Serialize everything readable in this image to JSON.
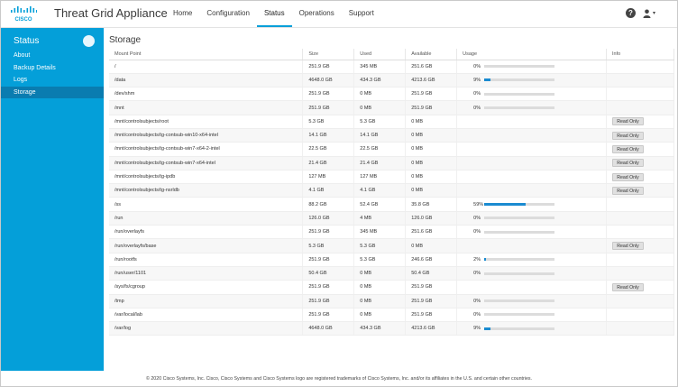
{
  "header": {
    "brand": "CISCO",
    "title": "Threat Grid Appliance",
    "nav": [
      "Home",
      "Configuration",
      "Status",
      "Operations",
      "Support"
    ],
    "active_nav": "Status",
    "help_glyph": "?"
  },
  "sidebar": {
    "title": "Status",
    "items": [
      "About",
      "Backup Details",
      "Logs",
      "Storage"
    ],
    "active": "Storage"
  },
  "main": {
    "title": "Storage",
    "columns": [
      "Mount Point",
      "Size",
      "Used",
      "Available",
      "Usage",
      "Info"
    ],
    "rows": [
      {
        "mount": "/",
        "size": "251.9 GB",
        "used": "345 MB",
        "avail": "251.6 GB",
        "usage": "0%",
        "pct": 0,
        "info": ""
      },
      {
        "mount": "/data",
        "size": "4648.0 GB",
        "used": "434.3 GB",
        "avail": "4213.6 GB",
        "usage": "9%",
        "pct": 9,
        "info": ""
      },
      {
        "mount": "/dev/shm",
        "size": "251.9 GB",
        "used": "0 MB",
        "avail": "251.9 GB",
        "usage": "0%",
        "pct": 0,
        "info": ""
      },
      {
        "mount": "/mnt",
        "size": "251.9 GB",
        "used": "0 MB",
        "avail": "251.9 GB",
        "usage": "0%",
        "pct": 0,
        "info": ""
      },
      {
        "mount": "/mnt/controlsubjects/root",
        "size": "5.3 GB",
        "used": "5.3 GB",
        "avail": "0 MB",
        "usage": "",
        "pct": null,
        "info": "Read Only"
      },
      {
        "mount": "/mnt/controlsubjects/tg-contsub-win10-x64-intel",
        "size": "14.1 GB",
        "used": "14.1 GB",
        "avail": "0 MB",
        "usage": "",
        "pct": null,
        "info": "Read Only"
      },
      {
        "mount": "/mnt/controlsubjects/tg-contsub-win7-x64-2-intel",
        "size": "22.5 GB",
        "used": "22.5 GB",
        "avail": "0 MB",
        "usage": "",
        "pct": null,
        "info": "Read Only"
      },
      {
        "mount": "/mnt/controlsubjects/tg-contsub-win7-x64-intel",
        "size": "21.4 GB",
        "used": "21.4 GB",
        "avail": "0 MB",
        "usage": "",
        "pct": null,
        "info": "Read Only"
      },
      {
        "mount": "/mnt/controlsubjects/tg-ipdb",
        "size": "127 MB",
        "used": "127 MB",
        "avail": "0 MB",
        "usage": "",
        "pct": null,
        "info": "Read Only"
      },
      {
        "mount": "/mnt/controlsubjects/tg-nsrldb",
        "size": "4.1 GB",
        "used": "4.1 GB",
        "avail": "0 MB",
        "usage": "",
        "pct": null,
        "info": "Read Only"
      },
      {
        "mount": "/ss",
        "size": "88.2 GB",
        "used": "52.4 GB",
        "avail": "35.8 GB",
        "usage": "59%",
        "pct": 59,
        "info": ""
      },
      {
        "mount": "/run",
        "size": "126.0 GB",
        "used": "4 MB",
        "avail": "126.0 GB",
        "usage": "0%",
        "pct": 0,
        "info": ""
      },
      {
        "mount": "/run/overlayfs",
        "size": "251.9 GB",
        "used": "345 MB",
        "avail": "251.6 GB",
        "usage": "0%",
        "pct": 0,
        "info": ""
      },
      {
        "mount": "/run/overlayfs/base",
        "size": "5.3 GB",
        "used": "5.3 GB",
        "avail": "0 MB",
        "usage": "",
        "pct": null,
        "info": "Read Only"
      },
      {
        "mount": "/run/rootfs",
        "size": "251.9 GB",
        "used": "5.3 GB",
        "avail": "246.6 GB",
        "usage": "2%",
        "pct": 2,
        "info": ""
      },
      {
        "mount": "/run/user/1101",
        "size": "50.4 GB",
        "used": "0 MB",
        "avail": "50.4 GB",
        "usage": "0%",
        "pct": 0,
        "info": ""
      },
      {
        "mount": "/sys/fs/cgroup",
        "size": "251.9 GB",
        "used": "0 MB",
        "avail": "251.9 GB",
        "usage": "",
        "pct": null,
        "info": "Read Only"
      },
      {
        "mount": "/tmp",
        "size": "251.9 GB",
        "used": "0 MB",
        "avail": "251.9 GB",
        "usage": "0%",
        "pct": 0,
        "info": ""
      },
      {
        "mount": "/var/local/lab",
        "size": "251.9 GB",
        "used": "0 MB",
        "avail": "251.9 GB",
        "usage": "0%",
        "pct": 0,
        "info": ""
      },
      {
        "mount": "/var/log",
        "size": "4648.0 GB",
        "used": "434.3 GB",
        "avail": "4213.6 GB",
        "usage": "9%",
        "pct": 9,
        "info": ""
      }
    ]
  },
  "footer": {
    "text": "© 2020 Cisco Systems, Inc. Cisco, Cisco Systems and Cisco Systems logo are registered trademarks of Cisco Systems, Inc. and/or its affiliates in the U.S. and certain other countries."
  },
  "colors": {
    "accent": "#049fd9",
    "sidebar_active": "#0a7cb0",
    "bar_fill": "#1a8bd1"
  },
  "icons": {
    "logo": "cisco-logo",
    "help": "help-icon",
    "user": "user-icon",
    "collapse": "collapse-icon"
  }
}
